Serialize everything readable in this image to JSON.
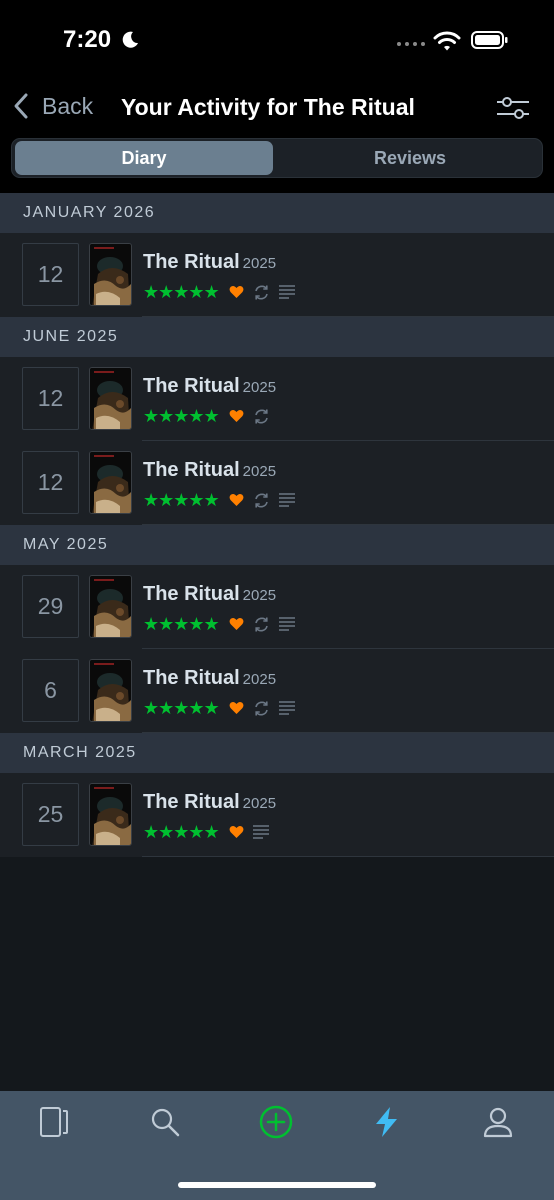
{
  "status_bar": {
    "time": "7:20"
  },
  "header": {
    "back_label": "Back",
    "title": "Your Activity for The Ritual",
    "tabs": [
      "Diary",
      "Reviews"
    ]
  },
  "colors": {
    "star": "#00c030",
    "heart": "#ff8000",
    "section_bg": "#2c3440",
    "row_bg": "#1c2025",
    "tabbar_bg": "#445566",
    "accent_blue": "#40bcf4"
  },
  "sections": [
    {
      "label": "JANUARY 2026",
      "entries": [
        {
          "day": "12",
          "title": "The Ritual",
          "year": "2025",
          "stars": "★★★★★",
          "liked": true,
          "rewatch": true,
          "review": true
        }
      ]
    },
    {
      "label": "JUNE 2025",
      "entries": [
        {
          "day": "12",
          "title": "The Ritual",
          "year": "2025",
          "stars": "★★★★★",
          "liked": true,
          "rewatch": true,
          "review": false
        },
        {
          "day": "12",
          "title": "The Ritual",
          "year": "2025",
          "stars": "★★★★★",
          "liked": true,
          "rewatch": true,
          "review": true
        }
      ]
    },
    {
      "label": "MAY 2025",
      "entries": [
        {
          "day": "29",
          "title": "The Ritual",
          "year": "2025",
          "stars": "★★★★★",
          "liked": true,
          "rewatch": true,
          "review": true
        },
        {
          "day": "6",
          "title": "The Ritual",
          "year": "2025",
          "stars": "★★★★★",
          "liked": true,
          "rewatch": true,
          "review": true
        }
      ]
    },
    {
      "label": "MARCH 2025",
      "entries": [
        {
          "day": "25",
          "title": "The Ritual",
          "year": "2025",
          "stars": "★★★★★",
          "liked": true,
          "rewatch": false,
          "review": true
        }
      ]
    }
  ],
  "tabbar": {
    "items": [
      "films-icon",
      "search-icon",
      "add-icon",
      "activity-icon",
      "profile-icon"
    ],
    "active": "activity-icon"
  }
}
